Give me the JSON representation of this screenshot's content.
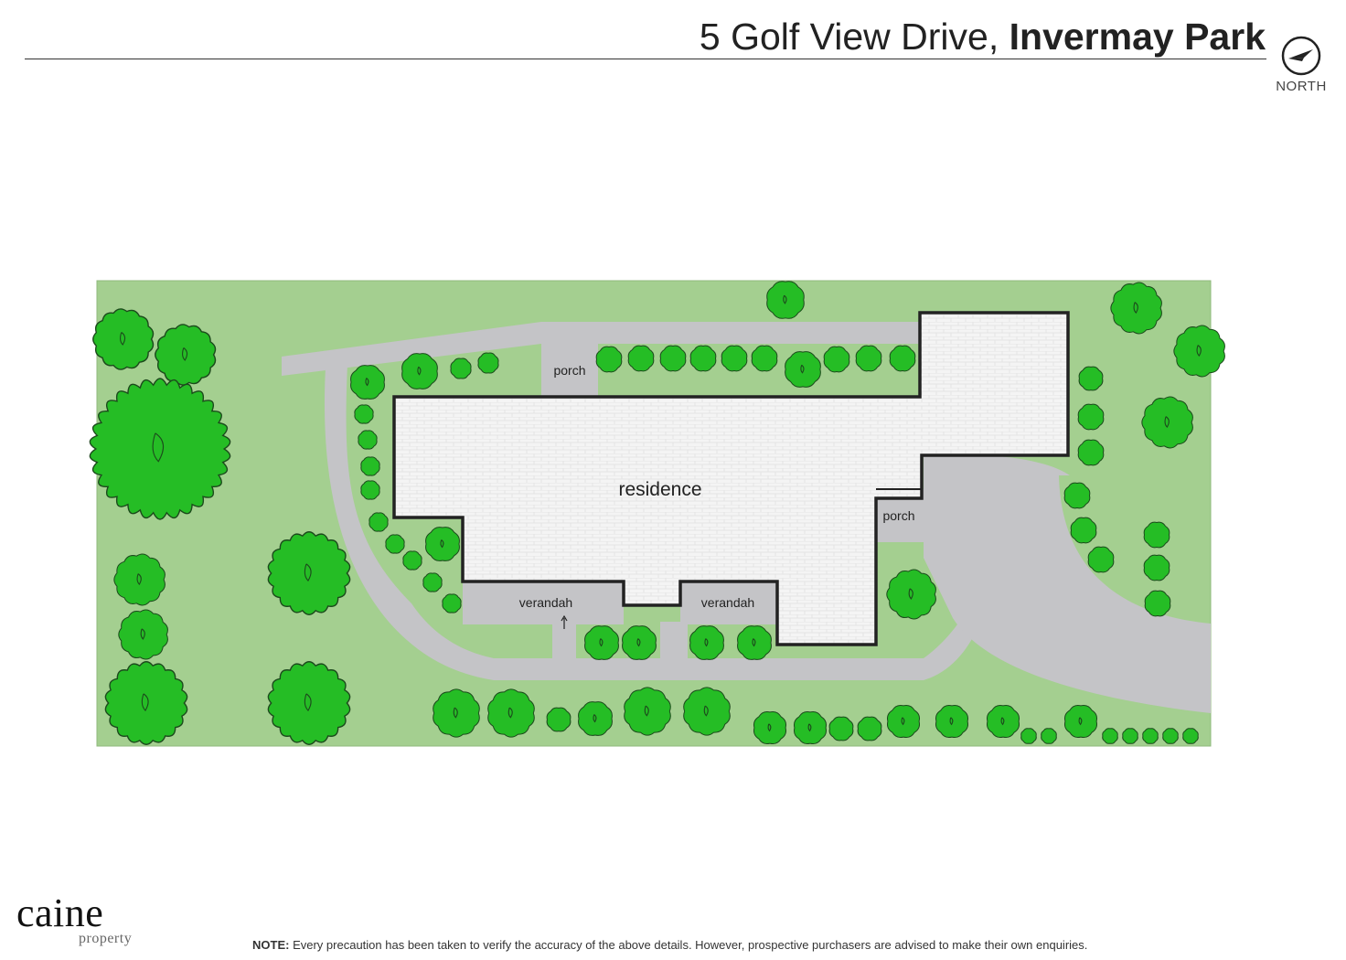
{
  "header": {
    "street": "5 Golf View Drive,",
    "suburb": "Invermay Park",
    "north_label": "NORTH"
  },
  "plan": {
    "labels": {
      "residence": "residence",
      "porch_top": "porch",
      "porch_right": "porch",
      "verandah_left": "verandah",
      "verandah_right": "verandah"
    }
  },
  "colors": {
    "lawn": "#a4cf90",
    "tree": "#25bd25",
    "tree_outline": "#1c4a1c",
    "paving": "#c4c4c7",
    "building_fill": "#f4f4f4",
    "building_outline": "#222222"
  },
  "footer": {
    "logo": "caine",
    "logo_sub": "property",
    "note_label": "NOTE:",
    "note_text": "Every precaution has been taken to verify the accuracy of the above details. However, prospective purchasers are advised to make their own enquiries."
  }
}
